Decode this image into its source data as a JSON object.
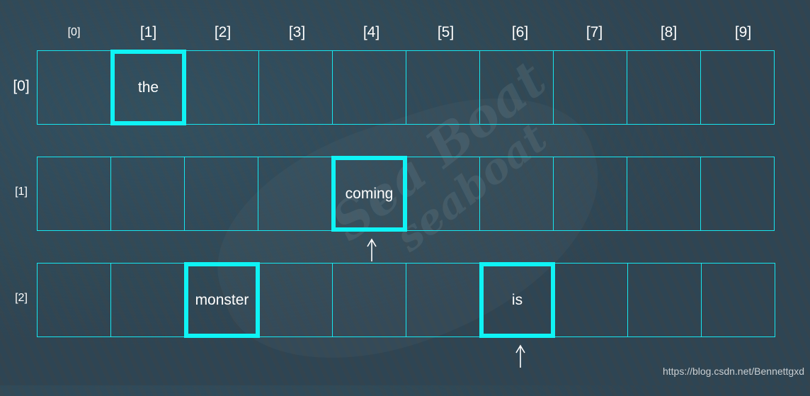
{
  "diagram": {
    "column_labels": [
      "[0]",
      "[1]",
      "[2]",
      "[3]",
      "[4]",
      "[5]",
      "[6]",
      "[7]",
      "[8]",
      "[9]"
    ],
    "row_labels": [
      "[0]",
      "[1]",
      "[2]"
    ],
    "rows": [
      [
        "",
        "the",
        "",
        "",
        "",
        "",
        "",
        "",
        "",
        ""
      ],
      [
        "",
        "",
        "",
        "",
        "coming",
        "",
        "",
        "",
        "",
        ""
      ],
      [
        "",
        "",
        "monster",
        "",
        "",
        "",
        "is",
        "",
        "",
        ""
      ]
    ],
    "highlighted_cells": [
      {
        "row": 0,
        "col": 1,
        "text": "the"
      },
      {
        "row": 1,
        "col": 4,
        "text": "coming"
      },
      {
        "row": 2,
        "col": 2,
        "text": "monster"
      },
      {
        "row": 2,
        "col": 6,
        "text": "is"
      }
    ],
    "arrows": [
      {
        "below_row": 1,
        "col": 4,
        "direction": "up"
      },
      {
        "below_row": 2,
        "col": 6,
        "direction": "up"
      }
    ],
    "colors": {
      "background": "#2f4451",
      "cell_border": "#17e6ee",
      "highlight_border": "#0ff3f5",
      "text": "#ffffff"
    }
  },
  "watermark": {
    "line1": "Sea Boat",
    "line2": "seaboat"
  },
  "credit": "https://blog.csdn.net/Bennettgxd"
}
